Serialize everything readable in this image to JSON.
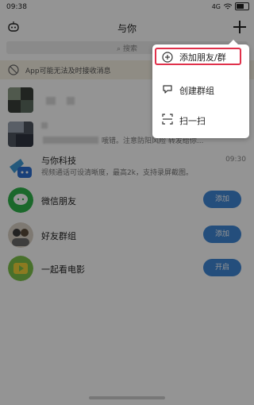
{
  "status": {
    "time": "09:38",
    "signal": "4G",
    "battery_label": ""
  },
  "header": {
    "title": "与你"
  },
  "search": {
    "placeholder": "搜索"
  },
  "notice": {
    "text": "App可能无法及时接收消息"
  },
  "rows": [
    {
      "title": "",
      "subtitle": "",
      "time": ""
    },
    {
      "title": "",
      "subtitle": "哦错。注意防阳风险 转发给你...",
      "time": ""
    },
    {
      "title": "与你科技",
      "subtitle": "视频通话可设清晰度，最高2k，支持录屏截图。",
      "time": "09:30"
    }
  ],
  "actions": [
    {
      "title": "微信朋友",
      "button": "添加",
      "color": "#2fb34a"
    },
    {
      "title": "好友群组",
      "button": "添加",
      "color": "#5a5a5a"
    },
    {
      "title": "一起看电影",
      "button": "开启",
      "color": "#7cc24a"
    }
  ],
  "menu": {
    "items": [
      {
        "label": "添加朋友/群",
        "icon": "plus-circle-icon"
      },
      {
        "label": "创建群组",
        "icon": "group-chat-icon"
      },
      {
        "label": "扫一扫",
        "icon": "scan-icon"
      }
    ]
  },
  "colors": {
    "accent": "#3f87d6",
    "highlight": "#e0314b",
    "overlay": "rgba(0,0,0,0.42)"
  }
}
